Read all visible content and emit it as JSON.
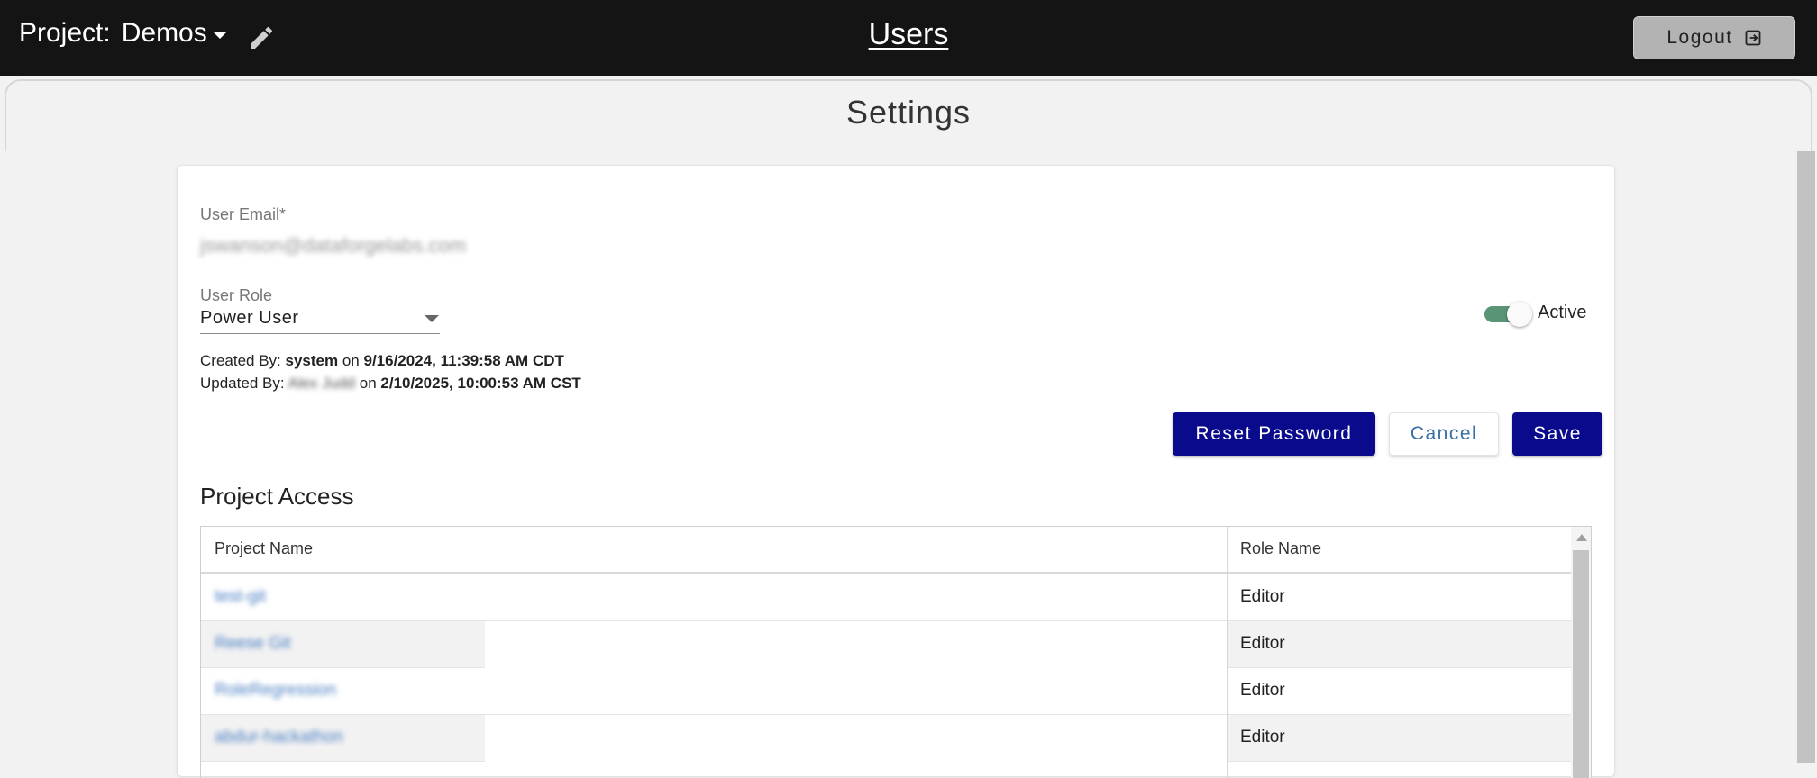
{
  "header": {
    "project_prefix": "Project:",
    "project_name": "Demos",
    "page_title": "Users",
    "logout_label": "Logout"
  },
  "panel": {
    "title": "Settings"
  },
  "form": {
    "email_label": "User Email*",
    "email_value": "jswanson@dataforgelabs.com",
    "role_label": "User Role",
    "role_value": "Power User",
    "active_label": "Active",
    "active": true,
    "created_prefix": "Created By:",
    "created_by": "system",
    "on_word": "on",
    "created_at": "9/16/2024, 11:39:58 AM CDT",
    "updated_prefix": "Updated By:",
    "updated_by": "Alex Judd",
    "updated_at": "2/10/2025, 10:00:53 AM CST"
  },
  "actions": {
    "reset_label": "Reset Password",
    "cancel_label": "Cancel",
    "save_label": "Save"
  },
  "project_access": {
    "title": "Project Access",
    "columns": [
      "Project Name",
      "Role Name"
    ],
    "rows": [
      {
        "project": "test-git",
        "role": "Editor"
      },
      {
        "project": "Reese Git",
        "role": "Editor"
      },
      {
        "project": "RoleRegression",
        "role": "Editor"
      },
      {
        "project": "abdur-hackathon",
        "role": "Editor"
      }
    ]
  },
  "colors": {
    "topbar": "#141414",
    "primary_button": "#0a0a8c",
    "toggle_track": "#5a9476",
    "link": "#4a7fc4"
  }
}
